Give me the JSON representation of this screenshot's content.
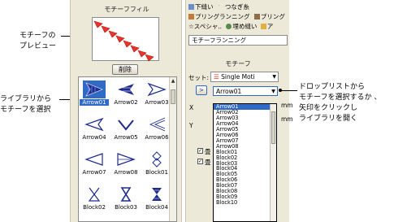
{
  "callouts": {
    "preview": [
      "モチーフの",
      "プレビュー"
    ],
    "library": [
      "ライブラリから",
      "モチーフを選択"
    ],
    "droplist": [
      "ドロップリストから",
      "モチーフを選択するか 、",
      "矢印をクリックし",
      "ライブラリを開く"
    ]
  },
  "left_panel": {
    "title": "モチーフフィル",
    "delete_label": "削除",
    "items": [
      {
        "label": "Arrow01",
        "icon": "arrow01-icon",
        "selected": true
      },
      {
        "label": "Arrow02",
        "icon": "arrow02-icon",
        "selected": false
      },
      {
        "label": "Arrow03",
        "icon": "arrow03-icon",
        "selected": false
      },
      {
        "label": "Arrow04",
        "icon": "arrow04-icon",
        "selected": false
      },
      {
        "label": "Arrow05",
        "icon": "arrow05-icon",
        "selected": false
      },
      {
        "label": "Arrow06",
        "icon": "arrow06-icon",
        "selected": false
      },
      {
        "label": "Arrow07",
        "icon": "arrow07-icon",
        "selected": false
      },
      {
        "label": "Arrow08",
        "icon": "arrow08-icon",
        "selected": false
      },
      {
        "label": "Block01",
        "icon": "block01-icon",
        "selected": false
      },
      {
        "label": "Block02",
        "icon": "block02-icon",
        "selected": false
      },
      {
        "label": "Block03",
        "icon": "block03-icon",
        "selected": false
      },
      {
        "label": "Block04",
        "icon": "block04-icon",
        "selected": false
      }
    ]
  },
  "right_panel": {
    "toolbar_row1": [
      "下縫い",
      "つなぎ糸"
    ],
    "toolbar_row2": [
      "プリングランニング",
      "プリング"
    ],
    "toolbar_row3": [
      "スペシャ..",
      "埋め縫い",
      "ア"
    ],
    "stitch_type": "モチーフランニング",
    "section_title": "モチーフ",
    "set_label": "セット:",
    "set_value": "Single Moti",
    "motif_value": "Arrow01",
    "side_labels": [
      "X",
      "Y"
    ],
    "mm_labels": [
      "mm",
      "mm"
    ],
    "check_labels": [
      "✓",
      "✓"
    ],
    "check_side": [
      "畳",
      "畳"
    ],
    "dropdown_items": [
      "Arrow01",
      "Arrow02",
      "Arrow03",
      "Arrow04",
      "Arrow05",
      "Arrow06",
      "Arrow07",
      "Arrow08",
      "Block01",
      "Block02",
      "Block03",
      "Block04",
      "Block05",
      "Block06",
      "Block07",
      "Block08",
      "Block09",
      "Block10"
    ]
  },
  "colors": {
    "panel_bg": "#ece9d8",
    "selection": "#316ac5",
    "motif_red": "#e8352c",
    "icon_blue": "#1e2b8f"
  }
}
